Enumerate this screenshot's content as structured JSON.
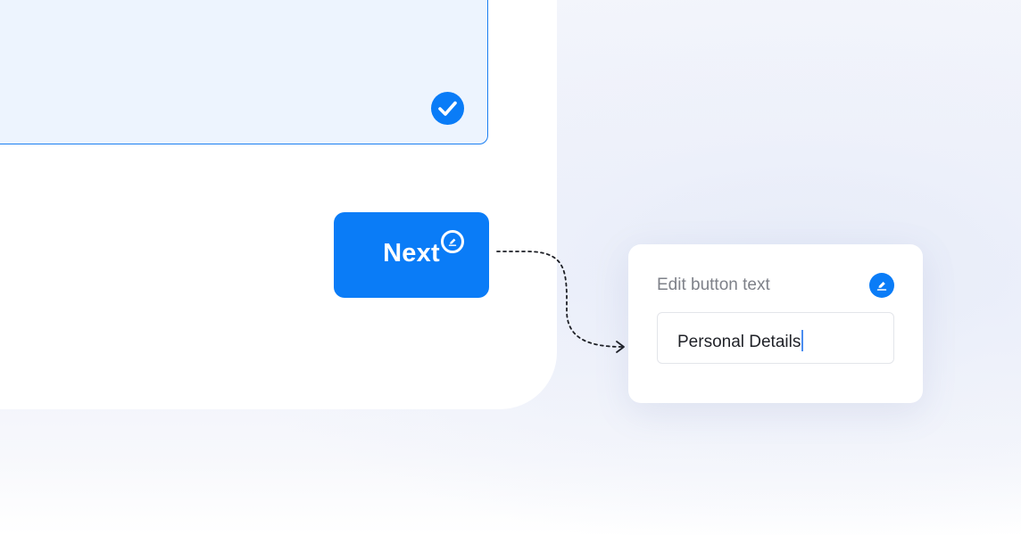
{
  "next_button": {
    "label": "Next"
  },
  "edit_panel": {
    "title": "Edit button text",
    "field_value": "Personal Details"
  },
  "icons": {
    "selected": "check-circle-icon",
    "button_edit": "pencil-badge-icon",
    "panel_edit": "pencil-circle-icon"
  },
  "colors": {
    "accent": "#0a7cf7",
    "selected_fill": "#edf4fe",
    "selected_border": "#1a7ef2",
    "panel_bg": "#ffffff",
    "muted_text": "#7e8189"
  }
}
